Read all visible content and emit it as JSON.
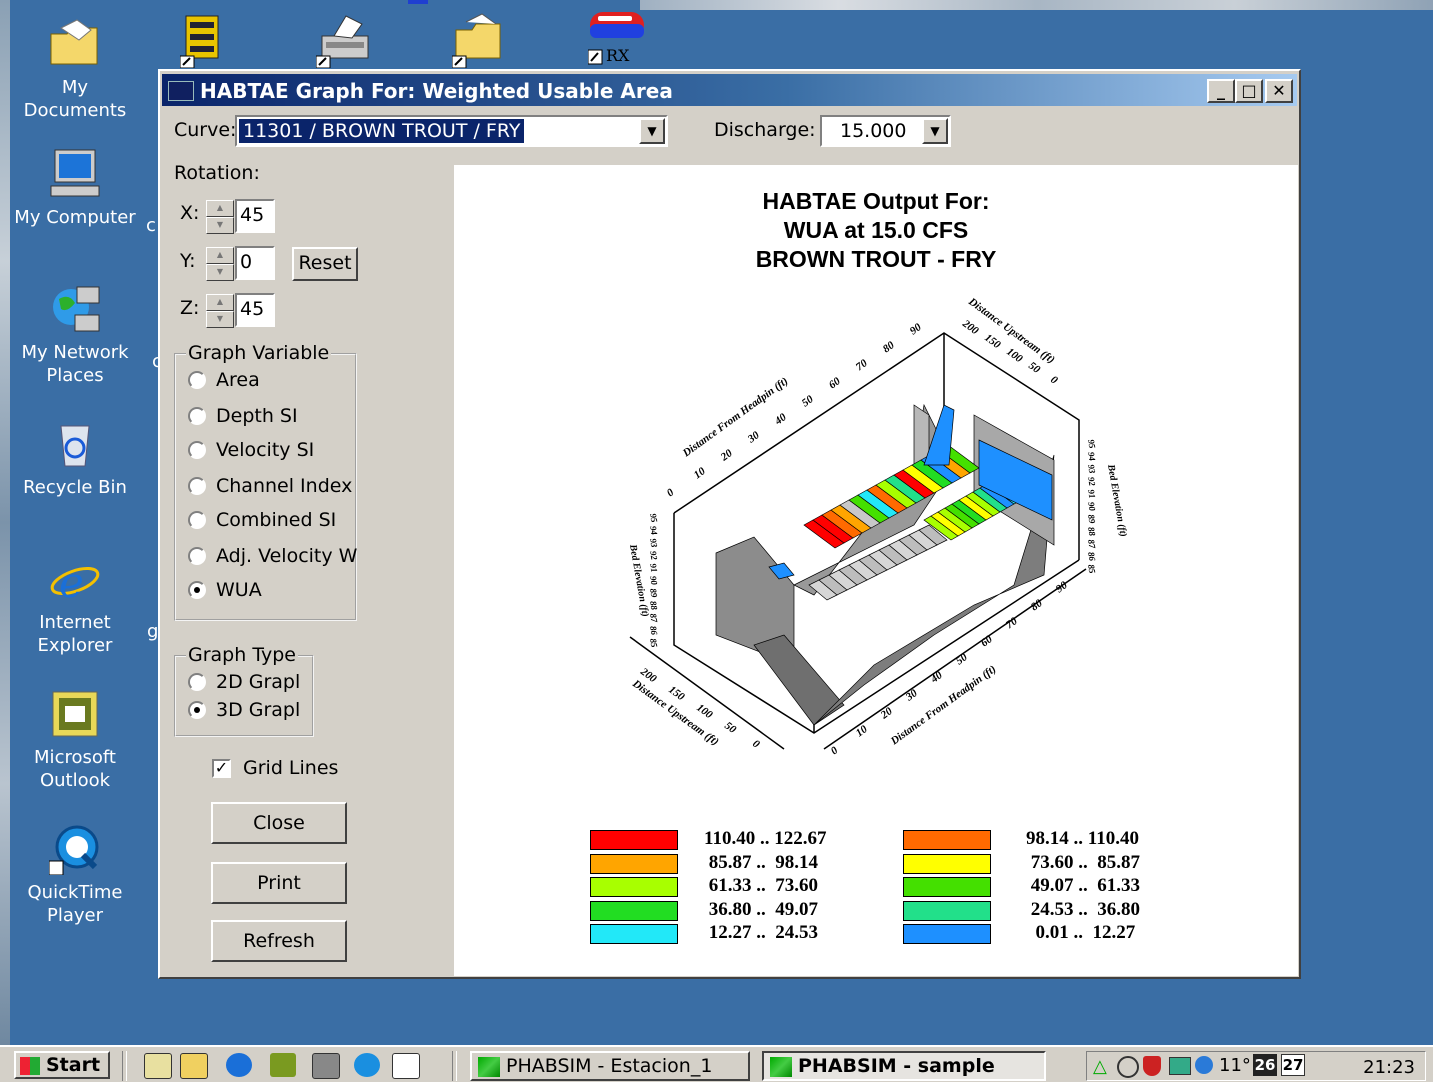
{
  "desktop": {
    "icons": [
      {
        "label_line1": "My Documents",
        "label_line2": ""
      },
      {
        "label_line1": "My Computer",
        "label_line2": ""
      },
      {
        "label_line1": "My Network",
        "label_line2": "Places"
      },
      {
        "label_line1": "Recycle Bin",
        "label_line2": ""
      },
      {
        "label_line1": "Internet",
        "label_line2": "Explorer"
      },
      {
        "label_line1": "Microsoft",
        "label_line2": "Outlook"
      },
      {
        "label_line1": "QuickTime",
        "label_line2": "Player"
      }
    ],
    "rx_label": "RX",
    "clipped_letters": [
      "c",
      "c",
      "g"
    ]
  },
  "window": {
    "title": "HABTAE Graph For: Weighted Usable Area",
    "minimize": "_",
    "maximize": "□",
    "close": "✕"
  },
  "controls": {
    "curve_label": "Curve:",
    "curve_value": "11301 / BROWN TROUT / FRY",
    "discharge_label": "Discharge:",
    "discharge_value": "15.000",
    "rotation_label": "Rotation:",
    "x_label": "X:",
    "x_value": "45",
    "y_label": "Y:",
    "y_value": "0",
    "z_label": "Z:",
    "z_value": "45",
    "reset_label": "Reset",
    "graph_variable_title": "Graph Variable",
    "graph_variable_options": [
      "Area",
      "Depth SI",
      "Velocity SI",
      "Channel Index",
      "Combined SI",
      "Adj. Velocity W",
      "WUA"
    ],
    "graph_variable_selected": "WUA",
    "graph_type_title": "Graph Type",
    "graph_type_options": [
      "2D Grapl",
      "3D Grapl"
    ],
    "graph_type_selected": "3D Grapl",
    "grid_lines_label": "Grid Lines",
    "grid_lines_checked": true,
    "close_label": "Close",
    "print_label": "Print",
    "refresh_label": "Refresh"
  },
  "chart": {
    "title_line1": "HABTAE Output For:",
    "title_line2": "WUA at    15.0 CFS",
    "title_line3": "BROWN TROUT - FRY"
  },
  "chart_data": {
    "type": "3d-surface",
    "axis_labels": {
      "front_x": "Distance From Headpin (ft)",
      "back_x": "Distance From Headpin (ft)",
      "front_depth": "Distance Upstream (ft)",
      "back_depth": "Distance Upstream (ft)",
      "left_z": "Bed Elevation (ft)",
      "right_z": "Bed Elevation (ft)"
    },
    "x_ticks": [
      "0",
      "10",
      "20",
      "30",
      "40",
      "50",
      "60",
      "70",
      "80",
      "90"
    ],
    "depth_ticks": [
      "0",
      "50",
      "100",
      "150",
      "200"
    ],
    "z_ticks": [
      "85",
      "86",
      "87",
      "88",
      "89",
      "90",
      "91",
      "92",
      "93",
      "94",
      "95"
    ],
    "legend": [
      {
        "range": "110.40 .. 122.67",
        "color": "#ff0000"
      },
      {
        "range": "98.14 .. 110.40",
        "color": "#ff6a00"
      },
      {
        "range": " 85.87 ..  98.14",
        "color": "#ffa500"
      },
      {
        "range": " 73.60 ..  85.87",
        "color": "#ffff00"
      },
      {
        "range": " 61.33 ..  73.60",
        "color": "#a8ff00"
      },
      {
        "range": " 49.07 ..  61.33",
        "color": "#44e000"
      },
      {
        "range": " 36.80 ..  49.07",
        "color": "#22dd22"
      },
      {
        "range": " 24.53 ..  36.80",
        "color": "#22e08a"
      },
      {
        "range": " 12.27 ..  24.53",
        "color": "#22e8f8"
      },
      {
        "range": "  0.01 ..  12.27",
        "color": "#1e90ff"
      }
    ]
  },
  "taskbar": {
    "start_label": "Start",
    "tasks": [
      "PHABSIM - Estacion_1",
      "PHABSIM - sample"
    ],
    "tray_temp": "11°",
    "tray_day1": "26",
    "tray_day2": "27",
    "clock": "21:23"
  }
}
